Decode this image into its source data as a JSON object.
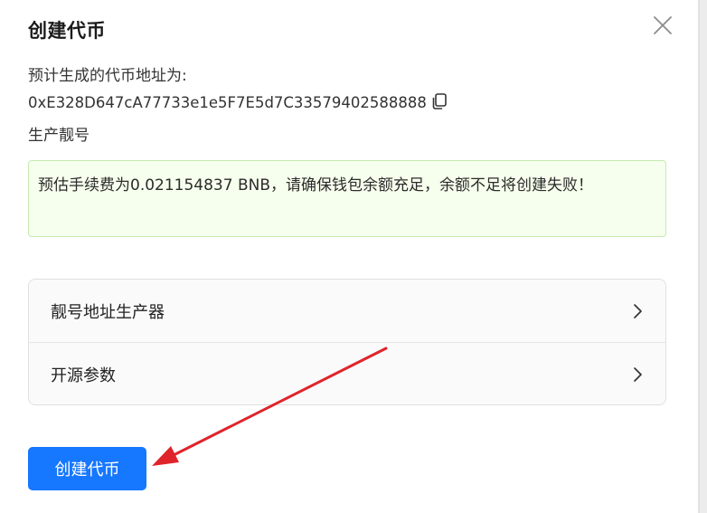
{
  "dialog": {
    "title": "创建代币"
  },
  "info": {
    "address_label": "预计生成的代币地址为:",
    "address_value": "0xE328D647cA77733e1e5F7E5d7C33579402588888",
    "vanity_label": "生产靓号"
  },
  "notice": {
    "text": "预估手续费为0.021154837 BNB，请确保钱包余额充足，余额不足将创建失败！"
  },
  "menu": {
    "items": [
      {
        "label": "靓号地址生产器"
      },
      {
        "label": "开源参数"
      }
    ]
  },
  "actions": {
    "create_label": "创建代币"
  },
  "colors": {
    "primary": "#1677ff",
    "notice_bg": "#f6ffed",
    "notice_border": "#c8eab0",
    "annotation_arrow": "#e0242b"
  },
  "icons": {
    "close": "close-icon",
    "copy": "copy-icon",
    "chevron": "chevron-right-icon"
  }
}
